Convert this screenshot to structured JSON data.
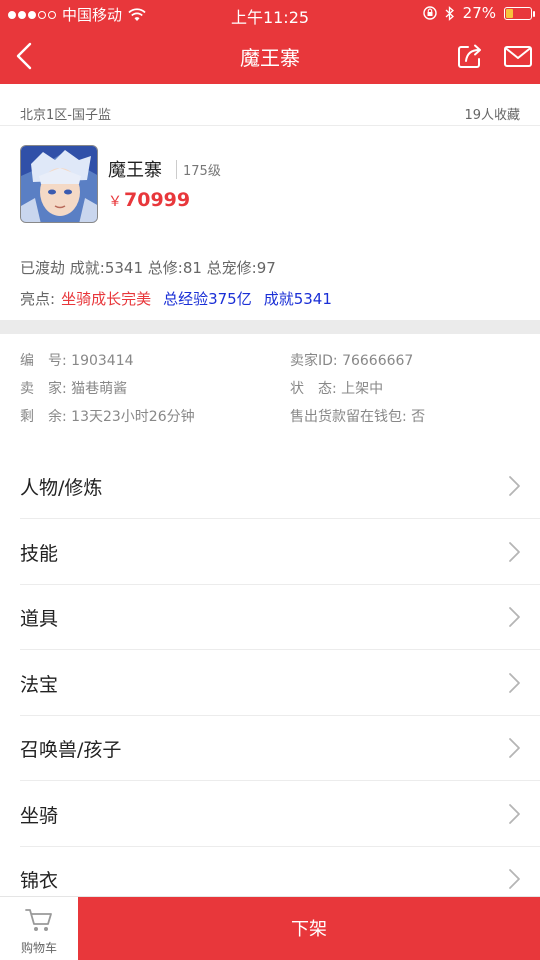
{
  "status_bar": {
    "carrier": "中国移动",
    "time": "上午11:25",
    "battery": "27%",
    "battery_level": 0.27
  },
  "nav": {
    "title": "魔王寨"
  },
  "server": {
    "name": "北京1区-国子监",
    "favorites": "19人收藏"
  },
  "character": {
    "name": "魔王寨",
    "level": "175级",
    "price_symbol": "￥",
    "price": "70999"
  },
  "stats": "已渡劫 成就:5341 总修:81 总宠修:97",
  "highlights": {
    "label": "亮点:",
    "items": [
      "坐骑成长完美",
      "总经验375亿",
      "成就5341"
    ]
  },
  "info": {
    "id": "编　号: 1903414",
    "seller_id": "卖家ID: 76666667",
    "seller": "卖　家: 猫巷萌酱",
    "status": "状　态: 上架中",
    "remaining": "剩　余: 13天23小时26分钟",
    "wallet": "售出货款留在钱包: 否"
  },
  "menu": [
    {
      "label": "人物/修炼"
    },
    {
      "label": "技能"
    },
    {
      "label": "道具"
    },
    {
      "label": "法宝"
    },
    {
      "label": "召唤兽/孩子"
    },
    {
      "label": "坐骑"
    },
    {
      "label": "锦衣"
    }
  ],
  "bottom": {
    "cart_label": "购物车",
    "delist_label": "下架"
  },
  "colors": {
    "accent": "#e8373b",
    "highlight_red": "#e8373b",
    "highlight_blue": "#1a2fd6"
  }
}
